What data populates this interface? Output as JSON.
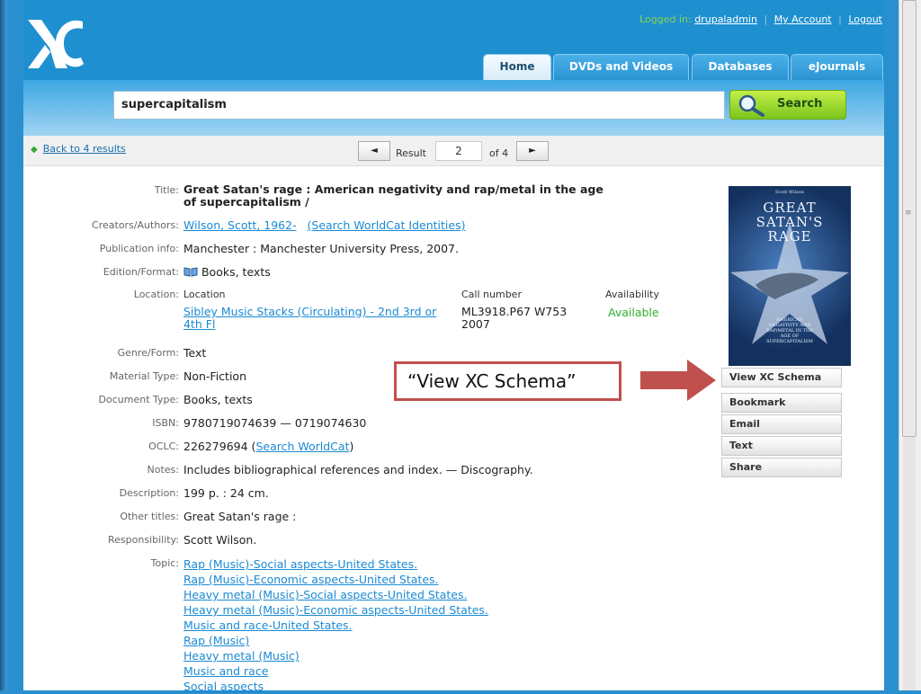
{
  "header": {
    "logged_in_label": "Logged in:",
    "username": "drupaladmin",
    "my_account": "My Account",
    "logout": "Logout"
  },
  "tabs": [
    "Home",
    "DVDs and Videos",
    "Databases",
    "eJournals"
  ],
  "search": {
    "value": "supercapitalism",
    "button_label": "Search"
  },
  "result_nav": {
    "back_label": "Back to 4 results",
    "prev": "◄",
    "result_label": "Result",
    "current": "2",
    "of_label": "of 4",
    "next": "►"
  },
  "record": {
    "title_label": "Title:",
    "title": "Great Satan's rage : American negativity and rap/metal in the age of supercapitalism /",
    "creators_label": "Creators/Authors:",
    "creator": "Wilson, Scott, 1962-",
    "creator_search": "(Search WorldCat Identities)",
    "pubinfo_label": "Publication info:",
    "pubinfo": "Manchester : Manchester University Press, 2007.",
    "edition_label": "Edition/Format:",
    "edition": "Books, texts",
    "location_label": "Location:",
    "loc_col_head": "Location",
    "call_col_head": "Call number",
    "avail_col_head": "Availability",
    "location_value": "Sibley Music Stacks (Circulating) - 2nd 3rd or 4th Fl",
    "call_number": "ML3918.P67 W753 2007",
    "availability": "Available",
    "genre_label": "Genre/Form:",
    "genre": "Text",
    "material_label": "Material Type:",
    "material": "Non-Fiction",
    "doctype_label": "Document Type:",
    "doctype": "Books, texts",
    "isbn_label": "ISBN:",
    "isbn": "9780719074639 — 0719074630",
    "oclc_label": "OCLC:",
    "oclc": "226279694",
    "oclc_search": "Search WorldCat",
    "notes_label": "Notes:",
    "notes": "Includes bibliographical references and index. — Discography.",
    "description_label": "Description:",
    "description": "199 p. : 24 cm.",
    "other_titles_label": "Other titles:",
    "other_titles": "Great Satan's rage :",
    "responsibility_label": "Responsibility:",
    "responsibility": "Scott Wilson.",
    "topic_label": "Topic:",
    "topics": [
      "Rap (Music)-Social aspects-United States.",
      "Rap (Music)-Economic aspects-United States.",
      "Heavy metal (Music)-Social aspects-United States.",
      "Heavy metal (Music)-Economic aspects-United States.",
      "Music and race-United States.",
      "Rap (Music)",
      "Heavy metal (Music)",
      "Music and race",
      "Social aspects"
    ]
  },
  "cover": {
    "author": "Scott Wilson",
    "title_line1": "GREAT",
    "title_line2": "SATAN'S",
    "title_line3": "RAGE",
    "subtitle": "AMERICAN NEGATIVITY AND RAP/METAL IN THE AGE OF SUPERCAPITALISM"
  },
  "actions": [
    "View XC Schema",
    "Bookmark",
    "Email",
    "Text",
    "Share"
  ],
  "annotation": {
    "text": "“View XC Schema”",
    "arrow_color": "#c0504d"
  }
}
